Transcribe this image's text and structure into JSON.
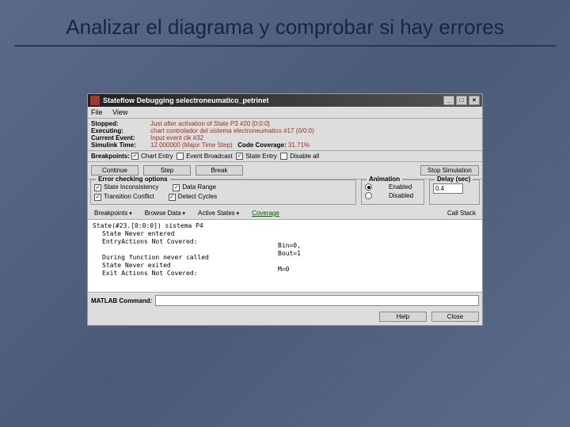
{
  "slide": {
    "title": "Analizar el diagrama y comprobar si hay errores"
  },
  "window": {
    "title": "Stateflow Debugging selectroneumatico_petrinet",
    "menu": {
      "file": "File",
      "view": "View"
    }
  },
  "status": {
    "stopped_label": "Stopped:",
    "stopped_value": "Just after activation of State P3 #20 [0:0:0]",
    "executing_label": "Executing:",
    "executing_value": "chart controlador del sistema electroneumatico #17 (0/0:0)",
    "current_event_label": "Current Event:",
    "current_event_value": "Input event clk #32",
    "simulink_time_label": "Simulink Time:",
    "simulink_time_value": "12.000000 (Major Time Step)",
    "code_coverage_label": "Code Coverage:",
    "code_coverage_value": "31.71%"
  },
  "breakpoints": {
    "label": "Breakpoints:",
    "chart_entry": "Chart Entry",
    "event_broadcast": "Event Broadcast",
    "state_entry": "State Entry",
    "disable_all": "Disable all"
  },
  "buttons": {
    "continue": "Continue",
    "step": "Step",
    "break": "Break",
    "stop_sim": "Stop Simulation",
    "help": "Help",
    "close": "Close"
  },
  "error_checking": {
    "legend": "Error checking options",
    "state_inconsistency": "State Inconsistency",
    "data_range": "Data Range",
    "transition_conflict": "Transition Conflict",
    "detect_cycles": "Detect Cycles"
  },
  "animation": {
    "legend": "Animation",
    "enabled": "Enabled",
    "disabled": "Disabled"
  },
  "delay": {
    "legend": "Delay (sec)",
    "value": "0.4"
  },
  "tabs": {
    "breakpoints": "Breakpoints",
    "browse_data": "Browse Data",
    "active_states": "Active States",
    "coverage": "Coverage",
    "call_stack": "Call Stack"
  },
  "content": {
    "line1": "State(#23.[0:0:0]) sistema P4",
    "line2": "State Never entered",
    "line3": "EntryActions Not Covered:",
    "line4": "During function never called",
    "line5": "State Never exited",
    "line6": "Exit Actions Not Covered:",
    "bin": "Bin=0,",
    "bout": "Bout=1",
    "m": "M=0"
  },
  "command": {
    "label": "MATLAB Command:"
  }
}
